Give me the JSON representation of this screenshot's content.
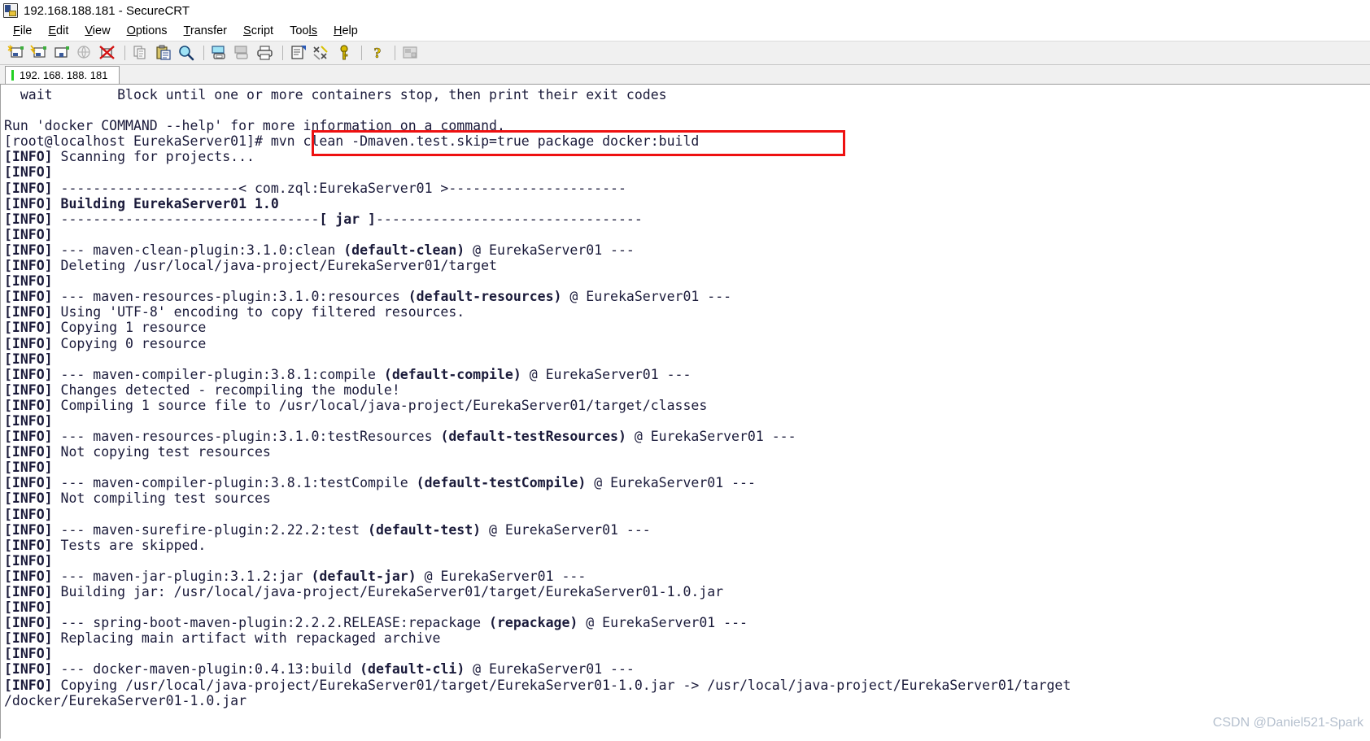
{
  "window": {
    "title": "192.168.188.181 - SecureCRT",
    "icon": "securecrt-app-icon"
  },
  "menubar": {
    "items": [
      {
        "name": "file",
        "pre": "F",
        "rest": "ile"
      },
      {
        "name": "edit",
        "pre": "E",
        "rest": "dit"
      },
      {
        "name": "view",
        "pre": "V",
        "rest": "iew"
      },
      {
        "name": "options",
        "pre": "O",
        "rest": "ptions"
      },
      {
        "name": "transfer",
        "pre": "T",
        "rest": "ransfer"
      },
      {
        "name": "script",
        "pre": "S",
        "rest": "cript"
      },
      {
        "name": "tools",
        "pre": "Too",
        "rest": "ls",
        "mid": true
      },
      {
        "name": "help",
        "pre": "H",
        "rest": "elp"
      }
    ]
  },
  "toolbar": {
    "buttons": [
      "new-session-icon",
      "clone-session-icon",
      "new-tab-icon",
      "connect-sftp-icon",
      "disconnect-icon",
      "sep",
      "copy-icon",
      "paste-icon",
      "find-icon",
      "sep",
      "print-screen-icon",
      "log-session-icon",
      "print-icon",
      "sep",
      "session-options-icon",
      "global-options-icon",
      "key-icon",
      "sep",
      "help-icon",
      "sep",
      "arrange-windows-icon"
    ]
  },
  "tabs": [
    {
      "label": "192. 168. 188. 181",
      "active": true,
      "marker_color": "#22d022"
    }
  ],
  "highlight": {
    "color": "#ee1111",
    "target_text": "mvn clean -Dmaven.test.skip=true package docker:build"
  },
  "watermark": {
    "text": "CSDN @Daniel521-Spark"
  },
  "terminal": {
    "prompt": "[root@localhost EurekaServer01]#",
    "command": "mvn clean -Dmaven.test.skip=true package docker:build",
    "lines": [
      "  wait        Block until one or more containers stop, then print their exit codes",
      "",
      "Run 'docker COMMAND --help' for more information on a command.",
      "[root@localhost EurekaServer01]# mvn clean -Dmaven.test.skip=true package docker:build",
      "[INFO] Scanning for projects...",
      "[INFO]",
      "[INFO] ----------------------< com.zql:EurekaServer01 >----------------------",
      "[INFO] Building EurekaServer01 1.0",
      "[INFO] --------------------------------[ jar ]---------------------------------",
      "[INFO]",
      "[INFO] --- maven-clean-plugin:3.1.0:clean (default-clean) @ EurekaServer01 ---",
      "[INFO] Deleting /usr/local/java-project/EurekaServer01/target",
      "[INFO]",
      "[INFO] --- maven-resources-plugin:3.1.0:resources (default-resources) @ EurekaServer01 ---",
      "[INFO] Using 'UTF-8' encoding to copy filtered resources.",
      "[INFO] Copying 1 resource",
      "[INFO] Copying 0 resource",
      "[INFO]",
      "[INFO] --- maven-compiler-plugin:3.8.1:compile (default-compile) @ EurekaServer01 ---",
      "[INFO] Changes detected - recompiling the module!",
      "[INFO] Compiling 1 source file to /usr/local/java-project/EurekaServer01/target/classes",
      "[INFO]",
      "[INFO] --- maven-resources-plugin:3.1.0:testResources (default-testResources) @ EurekaServer01 ---",
      "[INFO] Not copying test resources",
      "[INFO]",
      "[INFO] --- maven-compiler-plugin:3.8.1:testCompile (default-testCompile) @ EurekaServer01 ---",
      "[INFO] Not compiling test sources",
      "[INFO]",
      "[INFO] --- maven-surefire-plugin:2.22.2:test (default-test) @ EurekaServer01 ---",
      "[INFO] Tests are skipped.",
      "[INFO]",
      "[INFO] --- maven-jar-plugin:3.1.2:jar (default-jar) @ EurekaServer01 ---",
      "[INFO] Building jar: /usr/local/java-project/EurekaServer01/target/EurekaServer01-1.0.jar",
      "[INFO]",
      "[INFO] --- spring-boot-maven-plugin:2.2.2.RELEASE:repackage (repackage) @ EurekaServer01 ---",
      "[INFO] Replacing main artifact with repackaged archive",
      "[INFO]",
      "[INFO] --- docker-maven-plugin:0.4.13:build (default-cli) @ EurekaServer01 ---",
      "[INFO] Copying /usr/local/java-project/EurekaServer01/target/EurekaServer01-1.0.jar -> /usr/local/java-project/EurekaServer01/target",
      "/docker/EurekaServer01-1.0.jar"
    ],
    "bold_segments": [
      "[INFO]",
      "Building EurekaServer01 1.0",
      "(default-clean)",
      "(default-resources)",
      "(default-compile)",
      "(default-testResources)",
      "(default-testCompile)",
      "(default-test)",
      "(default-jar)",
      "(repackage)",
      "(default-cli)",
      "[ jar ]"
    ]
  }
}
